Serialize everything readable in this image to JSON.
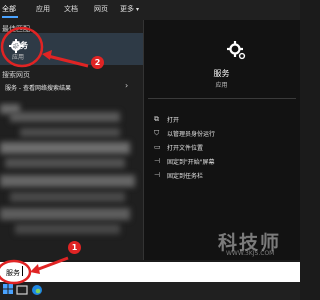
{
  "filters": {
    "tabs": [
      {
        "label": "全部"
      },
      {
        "label": "应用"
      },
      {
        "label": "文档"
      },
      {
        "label": "网页"
      },
      {
        "label": "更多"
      }
    ]
  },
  "results": {
    "best_match_header": "最佳匹配",
    "best_match": {
      "title": "服务",
      "subtitle": "应用"
    },
    "web_header": "搜索网页",
    "web_result": "服务 - 查看网络搜索结果"
  },
  "preview": {
    "title": "服务",
    "subtitle": "应用",
    "actions": [
      {
        "label": "打开",
        "icon": "open-icon"
      },
      {
        "label": "以管理员身份运行",
        "icon": "shield-icon"
      },
      {
        "label": "打开文件位置",
        "icon": "folder-icon"
      },
      {
        "label": "固定到\"开始\"屏幕",
        "icon": "pin-icon"
      },
      {
        "label": "固定到任务栏",
        "icon": "pin-taskbar-icon"
      }
    ]
  },
  "search": {
    "value": "服务"
  },
  "annotations": {
    "callout_1": "1",
    "callout_2": "2"
  },
  "watermark": {
    "title": "科技师",
    "url": "WWW.3KJS.COM"
  },
  "colors": {
    "accent": "#4aa3ff",
    "annotation": "#e02424",
    "selected_item_bg": "#2e3a46"
  }
}
